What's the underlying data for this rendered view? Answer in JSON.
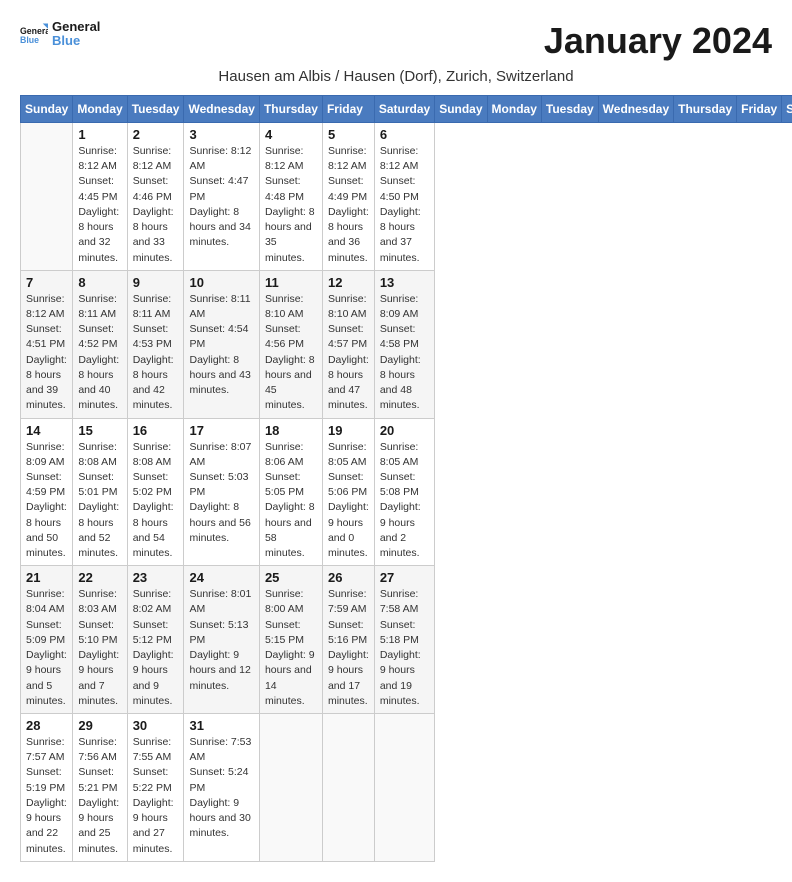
{
  "header": {
    "logo_general": "General",
    "logo_blue": "Blue",
    "month_title": "January 2024",
    "location": "Hausen am Albis / Hausen (Dorf), Zurich, Switzerland"
  },
  "weekdays": [
    "Sunday",
    "Monday",
    "Tuesday",
    "Wednesday",
    "Thursday",
    "Friday",
    "Saturday"
  ],
  "weeks": [
    [
      {
        "day": "",
        "sunrise": "",
        "sunset": "",
        "daylight": ""
      },
      {
        "day": "1",
        "sunrise": "Sunrise: 8:12 AM",
        "sunset": "Sunset: 4:45 PM",
        "daylight": "Daylight: 8 hours and 32 minutes."
      },
      {
        "day": "2",
        "sunrise": "Sunrise: 8:12 AM",
        "sunset": "Sunset: 4:46 PM",
        "daylight": "Daylight: 8 hours and 33 minutes."
      },
      {
        "day": "3",
        "sunrise": "Sunrise: 8:12 AM",
        "sunset": "Sunset: 4:47 PM",
        "daylight": "Daylight: 8 hours and 34 minutes."
      },
      {
        "day": "4",
        "sunrise": "Sunrise: 8:12 AM",
        "sunset": "Sunset: 4:48 PM",
        "daylight": "Daylight: 8 hours and 35 minutes."
      },
      {
        "day": "5",
        "sunrise": "Sunrise: 8:12 AM",
        "sunset": "Sunset: 4:49 PM",
        "daylight": "Daylight: 8 hours and 36 minutes."
      },
      {
        "day": "6",
        "sunrise": "Sunrise: 8:12 AM",
        "sunset": "Sunset: 4:50 PM",
        "daylight": "Daylight: 8 hours and 37 minutes."
      }
    ],
    [
      {
        "day": "7",
        "sunrise": "Sunrise: 8:12 AM",
        "sunset": "Sunset: 4:51 PM",
        "daylight": "Daylight: 8 hours and 39 minutes."
      },
      {
        "day": "8",
        "sunrise": "Sunrise: 8:11 AM",
        "sunset": "Sunset: 4:52 PM",
        "daylight": "Daylight: 8 hours and 40 minutes."
      },
      {
        "day": "9",
        "sunrise": "Sunrise: 8:11 AM",
        "sunset": "Sunset: 4:53 PM",
        "daylight": "Daylight: 8 hours and 42 minutes."
      },
      {
        "day": "10",
        "sunrise": "Sunrise: 8:11 AM",
        "sunset": "Sunset: 4:54 PM",
        "daylight": "Daylight: 8 hours and 43 minutes."
      },
      {
        "day": "11",
        "sunrise": "Sunrise: 8:10 AM",
        "sunset": "Sunset: 4:56 PM",
        "daylight": "Daylight: 8 hours and 45 minutes."
      },
      {
        "day": "12",
        "sunrise": "Sunrise: 8:10 AM",
        "sunset": "Sunset: 4:57 PM",
        "daylight": "Daylight: 8 hours and 47 minutes."
      },
      {
        "day": "13",
        "sunrise": "Sunrise: 8:09 AM",
        "sunset": "Sunset: 4:58 PM",
        "daylight": "Daylight: 8 hours and 48 minutes."
      }
    ],
    [
      {
        "day": "14",
        "sunrise": "Sunrise: 8:09 AM",
        "sunset": "Sunset: 4:59 PM",
        "daylight": "Daylight: 8 hours and 50 minutes."
      },
      {
        "day": "15",
        "sunrise": "Sunrise: 8:08 AM",
        "sunset": "Sunset: 5:01 PM",
        "daylight": "Daylight: 8 hours and 52 minutes."
      },
      {
        "day": "16",
        "sunrise": "Sunrise: 8:08 AM",
        "sunset": "Sunset: 5:02 PM",
        "daylight": "Daylight: 8 hours and 54 minutes."
      },
      {
        "day": "17",
        "sunrise": "Sunrise: 8:07 AM",
        "sunset": "Sunset: 5:03 PM",
        "daylight": "Daylight: 8 hours and 56 minutes."
      },
      {
        "day": "18",
        "sunrise": "Sunrise: 8:06 AM",
        "sunset": "Sunset: 5:05 PM",
        "daylight": "Daylight: 8 hours and 58 minutes."
      },
      {
        "day": "19",
        "sunrise": "Sunrise: 8:05 AM",
        "sunset": "Sunset: 5:06 PM",
        "daylight": "Daylight: 9 hours and 0 minutes."
      },
      {
        "day": "20",
        "sunrise": "Sunrise: 8:05 AM",
        "sunset": "Sunset: 5:08 PM",
        "daylight": "Daylight: 9 hours and 2 minutes."
      }
    ],
    [
      {
        "day": "21",
        "sunrise": "Sunrise: 8:04 AM",
        "sunset": "Sunset: 5:09 PM",
        "daylight": "Daylight: 9 hours and 5 minutes."
      },
      {
        "day": "22",
        "sunrise": "Sunrise: 8:03 AM",
        "sunset": "Sunset: 5:10 PM",
        "daylight": "Daylight: 9 hours and 7 minutes."
      },
      {
        "day": "23",
        "sunrise": "Sunrise: 8:02 AM",
        "sunset": "Sunset: 5:12 PM",
        "daylight": "Daylight: 9 hours and 9 minutes."
      },
      {
        "day": "24",
        "sunrise": "Sunrise: 8:01 AM",
        "sunset": "Sunset: 5:13 PM",
        "daylight": "Daylight: 9 hours and 12 minutes."
      },
      {
        "day": "25",
        "sunrise": "Sunrise: 8:00 AM",
        "sunset": "Sunset: 5:15 PM",
        "daylight": "Daylight: 9 hours and 14 minutes."
      },
      {
        "day": "26",
        "sunrise": "Sunrise: 7:59 AM",
        "sunset": "Sunset: 5:16 PM",
        "daylight": "Daylight: 9 hours and 17 minutes."
      },
      {
        "day": "27",
        "sunrise": "Sunrise: 7:58 AM",
        "sunset": "Sunset: 5:18 PM",
        "daylight": "Daylight: 9 hours and 19 minutes."
      }
    ],
    [
      {
        "day": "28",
        "sunrise": "Sunrise: 7:57 AM",
        "sunset": "Sunset: 5:19 PM",
        "daylight": "Daylight: 9 hours and 22 minutes."
      },
      {
        "day": "29",
        "sunrise": "Sunrise: 7:56 AM",
        "sunset": "Sunset: 5:21 PM",
        "daylight": "Daylight: 9 hours and 25 minutes."
      },
      {
        "day": "30",
        "sunrise": "Sunrise: 7:55 AM",
        "sunset": "Sunset: 5:22 PM",
        "daylight": "Daylight: 9 hours and 27 minutes."
      },
      {
        "day": "31",
        "sunrise": "Sunrise: 7:53 AM",
        "sunset": "Sunset: 5:24 PM",
        "daylight": "Daylight: 9 hours and 30 minutes."
      },
      {
        "day": "",
        "sunrise": "",
        "sunset": "",
        "daylight": ""
      },
      {
        "day": "",
        "sunrise": "",
        "sunset": "",
        "daylight": ""
      },
      {
        "day": "",
        "sunrise": "",
        "sunset": "",
        "daylight": ""
      }
    ]
  ]
}
